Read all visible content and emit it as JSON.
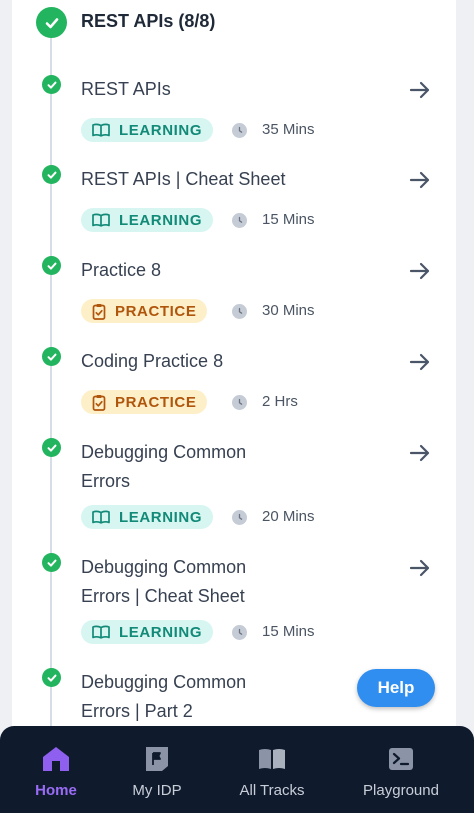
{
  "section": {
    "title": "REST APIs (8/8)"
  },
  "items": [
    {
      "title": "REST APIs",
      "tag": "LEARNING",
      "tag_type": "learning",
      "duration": "35 Mins"
    },
    {
      "title": "REST APIs | Cheat Sheet",
      "tag": "LEARNING",
      "tag_type": "learning",
      "duration": "15 Mins"
    },
    {
      "title": "Practice 8",
      "tag": "PRACTICE",
      "tag_type": "practice",
      "duration": "30 Mins"
    },
    {
      "title": "Coding Practice 8",
      "tag": "PRACTICE",
      "tag_type": "practice",
      "duration": "2 Hrs"
    },
    {
      "title": "Debugging Common Errors",
      "tag": "LEARNING",
      "tag_type": "learning",
      "duration": "20 Mins"
    },
    {
      "title": "Debugging Common Errors | Cheat Sheet",
      "tag": "LEARNING",
      "tag_type": "learning",
      "duration": "15 Mins"
    },
    {
      "title": "Debugging Common Errors | Part 2"
    }
  ],
  "help_button": {
    "label": "Help"
  },
  "bottom_nav": [
    {
      "label": "Home",
      "icon": "home-icon",
      "active": true
    },
    {
      "label": "My IDP",
      "icon": "flag-doc-icon",
      "active": false
    },
    {
      "label": "All Tracks",
      "icon": "book-icon",
      "active": false
    },
    {
      "label": "Playground",
      "icon": "terminal-icon",
      "active": false
    }
  ],
  "colors": {
    "completed": "#22b45e",
    "learning_bg": "#d7f6f1",
    "learning_text": "#138a78",
    "practice_bg": "#fdefc8",
    "practice_text": "#b0560c",
    "accent": "#9a6cf5",
    "help": "#2f8ef0",
    "nav_bg": "#0f1b2d"
  }
}
